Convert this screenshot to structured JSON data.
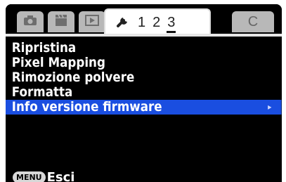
{
  "tabs": {
    "camera_icon": "camera-icon",
    "movie_icon": "movie-icon",
    "playback_icon": "playback-icon",
    "setup_icon": "wrench-icon",
    "pages": [
      "1",
      "2",
      "3"
    ],
    "active_page": "3",
    "custom_label": "C"
  },
  "menu": {
    "items": [
      {
        "label": "Ripristina",
        "selected": false
      },
      {
        "label": "Pixel Mapping",
        "selected": false
      },
      {
        "label": "Rimozione polvere",
        "selected": false
      },
      {
        "label": "Formatta",
        "selected": false
      },
      {
        "label": "Info versione firmware",
        "selected": true
      }
    ],
    "selected_arrow": "▸"
  },
  "footer": {
    "button": "MENU",
    "label": "Esci"
  },
  "colors": {
    "highlight": "#1a4ee0",
    "background": "#000000",
    "tab_inactive": "#b8b8b8"
  }
}
